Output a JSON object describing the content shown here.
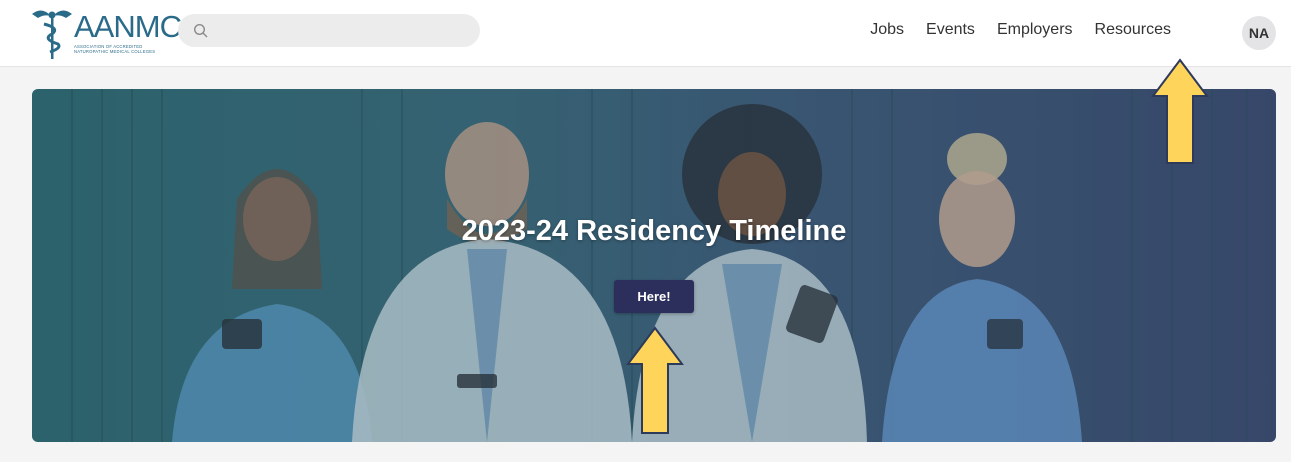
{
  "header": {
    "logo": {
      "wordmark": "AANMC",
      "tagline": "Association of Accredited Naturopathic Medical Colleges"
    },
    "search": {
      "placeholder": "",
      "value": ""
    },
    "nav": [
      {
        "label": "Jobs"
      },
      {
        "label": "Events"
      },
      {
        "label": "Employers"
      },
      {
        "label": "Resources"
      }
    ],
    "avatar_initials": "NA"
  },
  "hero": {
    "title": "2023-24 Residency Timeline",
    "button_label": "Here!"
  },
  "colors": {
    "brand_teal": "#2b6b8a",
    "button_navy": "#2c2f5c",
    "annotation_arrow": "#ffd45a"
  }
}
